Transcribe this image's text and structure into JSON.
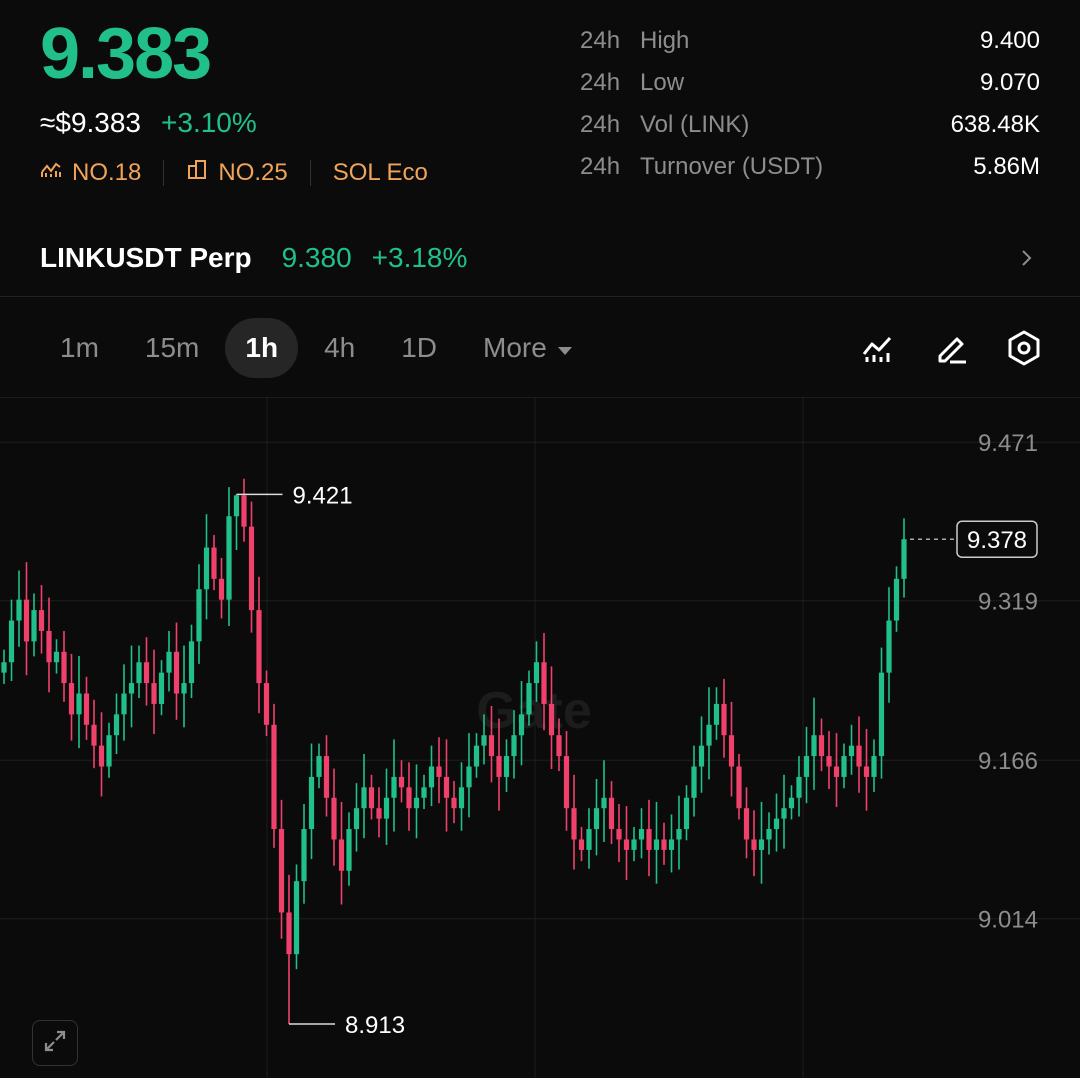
{
  "header": {
    "price": "9.383",
    "usd_price": "≈$9.383",
    "change_pct": "+3.10%",
    "rank_market_cap": "NO.18",
    "rank_sector": "NO.25",
    "ecosystem": "SOL Eco"
  },
  "stats": [
    {
      "period": "24h",
      "label": "High",
      "value": "9.400"
    },
    {
      "period": "24h",
      "label": "Low",
      "value": "9.070"
    },
    {
      "period": "24h",
      "label": "Vol (LINK)",
      "value": "638.48K"
    },
    {
      "period": "24h",
      "label": "Turnover (USDT)",
      "value": "5.86M"
    }
  ],
  "perp": {
    "name": "LINKUSDT Perp",
    "price": "9.380",
    "change_pct": "+3.18%"
  },
  "timeframes": {
    "tabs": [
      "1m",
      "15m",
      "1h",
      "4h",
      "1D"
    ],
    "active": "1h",
    "more_label": "More"
  },
  "colors": {
    "up": "#21c08b",
    "down": "#f0416c",
    "accent_orange": "#f0a45a",
    "background": "#0b0b0b"
  },
  "chart_data": {
    "type": "candlestick",
    "interval": "1h",
    "y_ticks": [
      "9.471",
      "9.319",
      "9.166",
      "9.014"
    ],
    "ylim": [
      8.89,
      9.5
    ],
    "max_label": "9.421",
    "min_label": "8.913",
    "last_price_label": "9.378",
    "watermark": "Gate",
    "closes": [
      9.26,
      9.3,
      9.32,
      9.28,
      9.31,
      9.29,
      9.26,
      9.27,
      9.24,
      9.21,
      9.23,
      9.2,
      9.18,
      9.16,
      9.19,
      9.21,
      9.23,
      9.24,
      9.26,
      9.24,
      9.22,
      9.25,
      9.27,
      9.23,
      9.24,
      9.28,
      9.33,
      9.37,
      9.34,
      9.32,
      9.4,
      9.42,
      9.39,
      9.31,
      9.24,
      9.2,
      9.1,
      9.02,
      8.98,
      9.05,
      9.1,
      9.15,
      9.17,
      9.13,
      9.09,
      9.06,
      9.1,
      9.12,
      9.14,
      9.12,
      9.11,
      9.13,
      9.15,
      9.14,
      9.12,
      9.13,
      9.14,
      9.16,
      9.15,
      9.13,
      9.12,
      9.14,
      9.16,
      9.18,
      9.19,
      9.17,
      9.15,
      9.17,
      9.19,
      9.21,
      9.24,
      9.26,
      9.22,
      9.19,
      9.17,
      9.12,
      9.09,
      9.08,
      9.1,
      9.12,
      9.13,
      9.1,
      9.09,
      9.08,
      9.09,
      9.1,
      9.08,
      9.09,
      9.08,
      9.09,
      9.1,
      9.13,
      9.16,
      9.18,
      9.2,
      9.22,
      9.19,
      9.16,
      9.12,
      9.09,
      9.08,
      9.09,
      9.1,
      9.11,
      9.12,
      9.13,
      9.15,
      9.17,
      9.19,
      9.17,
      9.16,
      9.15,
      9.17,
      9.18,
      9.16,
      9.15,
      9.17,
      9.25,
      9.3,
      9.34,
      9.378
    ]
  }
}
